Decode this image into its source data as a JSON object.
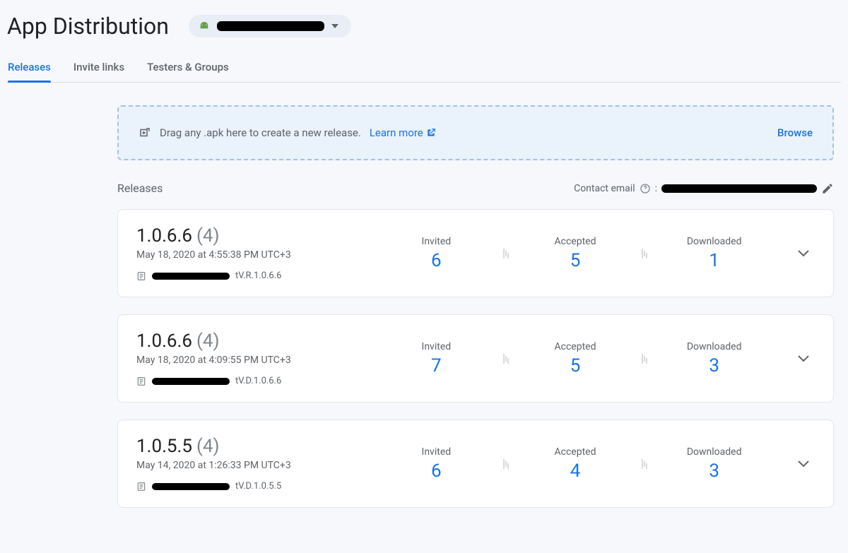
{
  "page": {
    "title": "App Distribution"
  },
  "tabs": [
    {
      "label": "Releases"
    },
    {
      "label": "Invite links"
    },
    {
      "label": "Testers & Groups"
    }
  ],
  "dropzone": {
    "text": "Drag any .apk here to create a new release.",
    "learn_more": "Learn more",
    "browse": "Browse"
  },
  "releases_section": {
    "title": "Releases",
    "contact_label": "Contact email"
  },
  "stat_labels": {
    "invited": "Invited",
    "accepted": "Accepted",
    "downloaded": "Downloaded"
  },
  "releases": [
    {
      "version": "1.0.6.6",
      "count": "(4)",
      "timestamp": "May 18, 2020 at 4:55:38 PM UTC+3",
      "filename_suffix": "tV.R.1.0.6.6",
      "invited": "6",
      "accepted": "5",
      "downloaded": "1"
    },
    {
      "version": "1.0.6.6",
      "count": "(4)",
      "timestamp": "May 18, 2020 at 4:09:55 PM UTC+3",
      "filename_suffix": "tV.D.1.0.6.6",
      "invited": "7",
      "accepted": "5",
      "downloaded": "3"
    },
    {
      "version": "1.0.5.5",
      "count": "(4)",
      "timestamp": "May 14, 2020 at 1:26:33 PM UTC+3",
      "filename_suffix": "tV.D.1.0.5.5",
      "invited": "6",
      "accepted": "4",
      "downloaded": "3"
    }
  ]
}
